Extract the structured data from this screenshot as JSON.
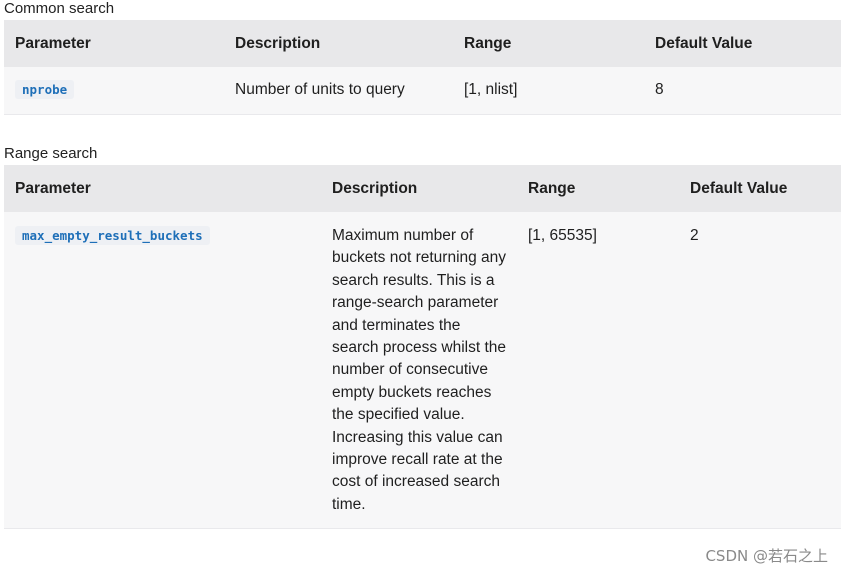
{
  "common": {
    "title": "Common search",
    "headers": [
      "Parameter",
      "Description",
      "Range",
      "Default Value"
    ],
    "row": {
      "param": "nprobe",
      "desc": "Number of units to query",
      "range": "[1, nlist]",
      "default": "8"
    }
  },
  "range": {
    "title": "Range search",
    "headers": [
      "Parameter",
      "Description",
      "Range",
      "Default Value"
    ],
    "row": {
      "param": "max_empty_result_buckets",
      "desc": "Maximum number of buckets not returning any search results. This is a range-search parameter and terminates the search process whilst the number of consecutive empty buckets reaches the specified value. Increasing this value can improve recall rate at the cost of increased search time.",
      "range": "[1, 65535]",
      "default": "2"
    }
  },
  "watermark": "CSDN @若石之上"
}
